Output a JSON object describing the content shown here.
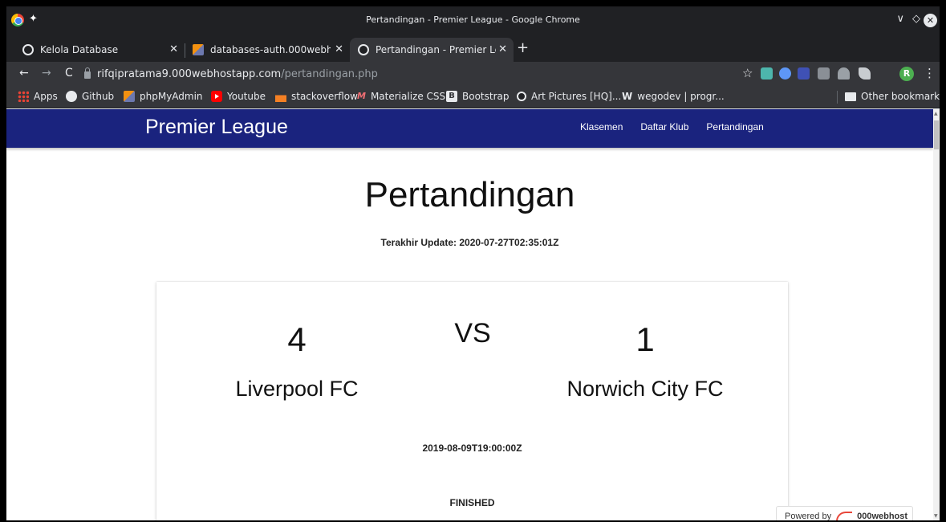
{
  "window": {
    "title": "Pertandingan - Premier League - Google Chrome",
    "controls": {
      "minimize": "∨",
      "maximize": "◇",
      "close": "✕"
    }
  },
  "tabs": [
    {
      "label": "Kelola Database",
      "icon": "globe-icon",
      "active": false
    },
    {
      "label": "databases-auth.000webhost",
      "icon": "phpmyadmin-icon",
      "active": false
    },
    {
      "label": "Pertandingan - Premier Leag",
      "icon": "globe-icon",
      "active": true
    }
  ],
  "newtab_label": "+",
  "toolbar": {
    "back": "←",
    "forward": "→",
    "reload": "C",
    "url_host": "rifqipratama9.000webhostapp.com",
    "url_path": "/pertandingan.php",
    "star": "☆",
    "avatar_letter": "R",
    "menu": "⋮"
  },
  "bookmarks": [
    {
      "label": "Apps",
      "icon": "apps-grid-icon"
    },
    {
      "label": "Github",
      "icon": "github-icon"
    },
    {
      "label": "phpMyAdmin",
      "icon": "phpmyadmin-icon"
    },
    {
      "label": "Youtube",
      "icon": "youtube-icon"
    },
    {
      "label": "stackoverflow",
      "icon": "stackoverflow-icon"
    },
    {
      "label": "Materialize CSS",
      "icon": "materialize-icon"
    },
    {
      "label": "Bootstrap",
      "icon": "bootstrap-icon"
    },
    {
      "label": "Art Pictures [HQ]...",
      "icon": "globe-icon"
    },
    {
      "label": "wegodev | progr...",
      "icon": "wegodev-icon"
    }
  ],
  "other_bookmarks": "Other bookmarks",
  "site": {
    "brand": "Premier League",
    "nav": [
      "Klasemen",
      "Daftar Klub",
      "Pertandingan"
    ],
    "page_title": "Pertandingan",
    "updated": "Terakhir Update: 2020-07-27T02:35:01Z"
  },
  "match": {
    "home_score": "4",
    "vs": "VS",
    "away_score": "1",
    "home_team": "Liverpool FC",
    "away_team": "Norwich City FC",
    "date": "2019-08-09T19:00:00Z",
    "status": "FINISHED"
  },
  "footer_badge": {
    "prefix": "Powered by",
    "name": "000webhost"
  }
}
